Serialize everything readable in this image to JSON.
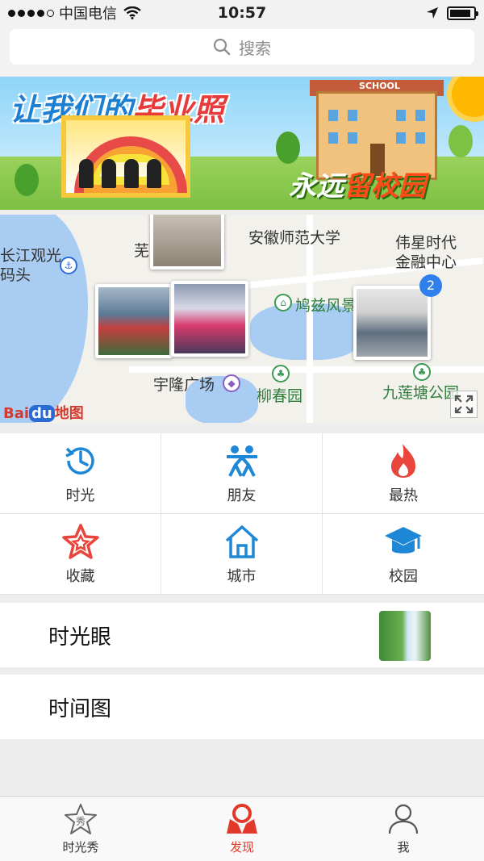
{
  "status_bar": {
    "carrier": "中国电信",
    "time": "10:57"
  },
  "search": {
    "placeholder": "搜索"
  },
  "banner": {
    "title_part1": "让我们的",
    "title_part2": "毕业照",
    "school_sign": "SCHOOL",
    "slogan_part1": "永远",
    "slogan_part2": "留校园"
  },
  "map": {
    "labels": {
      "changjiang": "长江观光",
      "matou": "码头",
      "wu": "芜",
      "anhui_normal": "安徽师范大学",
      "weixing_line1": "伟星时代",
      "weixing_line2": "金融中心",
      "jiuzi": "鸠兹风景",
      "yulong": "宇隆广场",
      "liuchun": "柳春园",
      "jiulian": "九莲塘公园"
    },
    "cluster_count": "2",
    "baidu_logo_text": "Bai",
    "baidu_logo_du": "du",
    "baidu_logo_suffix": "地图"
  },
  "grid": {
    "items": [
      {
        "label": "时光",
        "icon": "clock-icon",
        "color": "#1e88d6"
      },
      {
        "label": "朋友",
        "icon": "friends-icon",
        "color": "#1e88d6"
      },
      {
        "label": "最热",
        "icon": "flame-icon",
        "color": "#e8453c"
      },
      {
        "label": "收藏",
        "icon": "star-icon",
        "color": "#e8453c"
      },
      {
        "label": "城市",
        "icon": "home-icon",
        "color": "#1e88d6"
      },
      {
        "label": "校园",
        "icon": "graduation-cap-icon",
        "color": "#1e88d6"
      }
    ]
  },
  "rows": {
    "time_eye": "时光眼",
    "time_map": "时间图"
  },
  "tabs": [
    {
      "label": "时光秀",
      "icon": "star-show-icon"
    },
    {
      "label": "发现",
      "icon": "discover-icon",
      "active": true
    },
    {
      "label": "我",
      "icon": "user-icon"
    }
  ],
  "colors": {
    "accent_red": "#e23a2a",
    "icon_blue": "#1e88d6",
    "badge_blue": "#2f80ed"
  }
}
